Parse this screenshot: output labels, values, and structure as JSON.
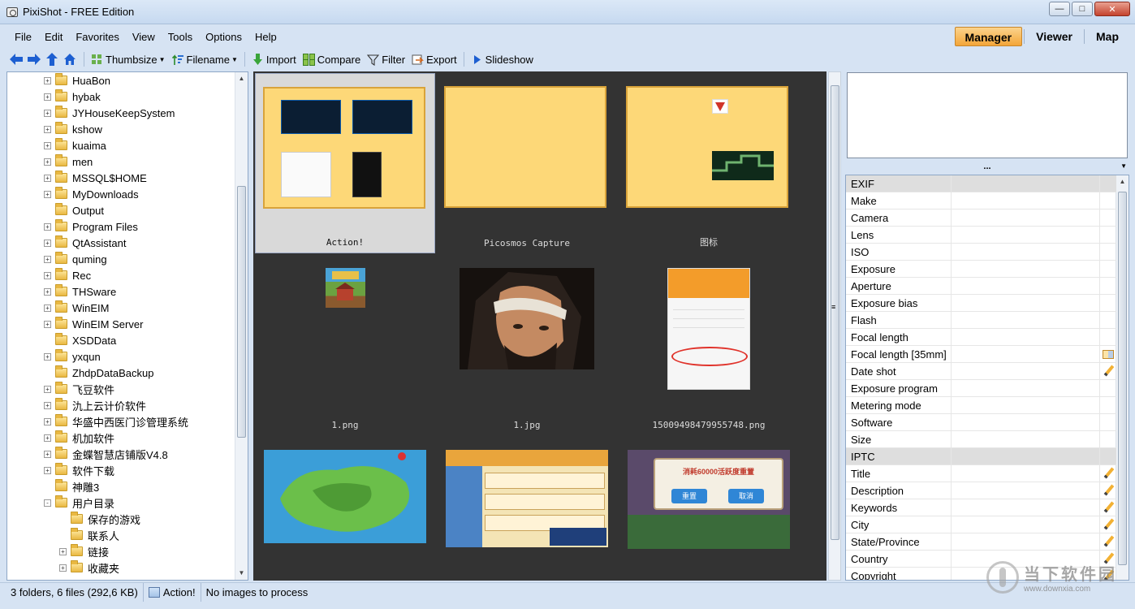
{
  "window": {
    "title": "PixiShot  -  FREE Edition"
  },
  "menu": [
    "File",
    "Edit",
    "Favorites",
    "View",
    "Tools",
    "Options",
    "Help"
  ],
  "modes": [
    {
      "label": "Manager",
      "active": true
    },
    {
      "label": "Viewer",
      "active": false
    },
    {
      "label": "Map",
      "active": false
    }
  ],
  "toolbar": {
    "thumbsize": "Thumbsize",
    "filename": "Filename",
    "import": "Import",
    "compare": "Compare",
    "filter": "Filter",
    "export": "Export",
    "slideshow": "Slideshow"
  },
  "tree": [
    {
      "label": "HuaBon",
      "expander": "+",
      "level": 1,
      "icon": "folder-icon"
    },
    {
      "label": "hybak",
      "expander": "+",
      "level": 1,
      "icon": "folder-icon"
    },
    {
      "label": "JYHouseKeepSystem",
      "expander": "+",
      "level": 1,
      "icon": "folder-icon"
    },
    {
      "label": "kshow",
      "expander": "+",
      "level": 1,
      "icon": "folder-icon"
    },
    {
      "label": "kuaima",
      "expander": "+",
      "level": 1,
      "icon": "folder-icon"
    },
    {
      "label": "men",
      "expander": "+",
      "level": 1,
      "icon": "folder-icon"
    },
    {
      "label": "MSSQL$HOME",
      "expander": "+",
      "level": 1,
      "icon": "folder-icon"
    },
    {
      "label": "MyDownloads",
      "expander": "+",
      "level": 1,
      "icon": "folder-icon"
    },
    {
      "label": "Output",
      "expander": "",
      "level": 1,
      "icon": "folder-icon"
    },
    {
      "label": "Program Files",
      "expander": "+",
      "level": 1,
      "icon": "folder-icon"
    },
    {
      "label": "QtAssistant",
      "expander": "+",
      "level": 1,
      "icon": "folder-icon"
    },
    {
      "label": "quming",
      "expander": "+",
      "level": 1,
      "icon": "folder-icon"
    },
    {
      "label": "Rec",
      "expander": "+",
      "level": 1,
      "icon": "folder-icon"
    },
    {
      "label": "THSware",
      "expander": "+",
      "level": 1,
      "icon": "folder-icon"
    },
    {
      "label": "WinEIM",
      "expander": "+",
      "level": 1,
      "icon": "folder-icon"
    },
    {
      "label": "WinEIM Server",
      "expander": "+",
      "level": 1,
      "icon": "folder-icon"
    },
    {
      "label": "XSDData",
      "expander": "",
      "level": 1,
      "icon": "folder-icon"
    },
    {
      "label": "yxqun",
      "expander": "+",
      "level": 1,
      "icon": "folder-icon"
    },
    {
      "label": "ZhdpDataBackup",
      "expander": "",
      "level": 1,
      "icon": "folder-icon"
    },
    {
      "label": "飞豆软件",
      "expander": "+",
      "level": 1,
      "icon": "folder-icon"
    },
    {
      "label": "氿上云计价软件",
      "expander": "+",
      "level": 1,
      "icon": "folder-icon"
    },
    {
      "label": "华盛中西医门诊管理系统",
      "expander": "+",
      "level": 1,
      "icon": "folder-icon"
    },
    {
      "label": "机加软件",
      "expander": "+",
      "level": 1,
      "icon": "folder-icon"
    },
    {
      "label": "金蝶智慧店铺版V4.8",
      "expander": "+",
      "level": 1,
      "icon": "folder-icon"
    },
    {
      "label": "软件下载",
      "expander": "+",
      "level": 1,
      "icon": "folder-icon"
    },
    {
      "label": "神雕3",
      "expander": "",
      "level": 1,
      "icon": "folder-icon"
    },
    {
      "label": "用户目录",
      "expander": "-",
      "level": 1,
      "icon": "folder-icon"
    },
    {
      "label": "保存的游戏",
      "expander": "",
      "level": 2,
      "icon": "folder-icon"
    },
    {
      "label": "联系人",
      "expander": "",
      "level": 2,
      "icon": "folder-icon"
    },
    {
      "label": "链接",
      "expander": "+",
      "level": 2,
      "icon": "folder-icon"
    },
    {
      "label": "收藏夹",
      "expander": "+",
      "level": 2,
      "icon": "folder-icon"
    }
  ],
  "thumbnails": [
    {
      "caption": "Action!",
      "kind": "folder",
      "selected": true
    },
    {
      "caption": "Picosmos Capture",
      "kind": "folder-empty",
      "selected": false
    },
    {
      "caption": "图标",
      "kind": "folder-icons",
      "selected": false
    },
    {
      "caption": "1.png",
      "kind": "image-small",
      "selected": false
    },
    {
      "caption": "1.jpg",
      "kind": "image-portrait",
      "selected": false
    },
    {
      "caption": "15009498479955748.png",
      "kind": "image-phone",
      "selected": false
    },
    {
      "caption": "",
      "kind": "image-map",
      "selected": false
    },
    {
      "caption": "",
      "kind": "image-game",
      "selected": false
    },
    {
      "caption": "",
      "kind": "image-dialog",
      "selected": false
    }
  ],
  "thumb_texts": {
    "dialog_title": "消耗60000活跃度重置",
    "ok": "重置",
    "cancel": "取消"
  },
  "splitter": "...",
  "properties": [
    {
      "key": "EXIF",
      "header": true,
      "edit": ""
    },
    {
      "key": "Make",
      "edit": ""
    },
    {
      "key": "Camera",
      "edit": ""
    },
    {
      "key": "Lens",
      "edit": ""
    },
    {
      "key": "ISO",
      "edit": ""
    },
    {
      "key": "Exposure",
      "edit": ""
    },
    {
      "key": "Aperture",
      "edit": ""
    },
    {
      "key": "Exposure bias",
      "edit": ""
    },
    {
      "key": "Flash",
      "edit": ""
    },
    {
      "key": "Focal length",
      "edit": ""
    },
    {
      "key": "Focal length [35mm]",
      "edit": "grid"
    },
    {
      "key": "Date shot",
      "edit": "pencil"
    },
    {
      "key": "Exposure program",
      "edit": ""
    },
    {
      "key": "Metering mode",
      "edit": ""
    },
    {
      "key": "Software",
      "edit": ""
    },
    {
      "key": "Size",
      "edit": ""
    },
    {
      "key": "IPTC",
      "header": true,
      "edit": ""
    },
    {
      "key": "Title",
      "edit": "pencil"
    },
    {
      "key": "Description",
      "edit": "pencil"
    },
    {
      "key": "Keywords",
      "edit": "pencil"
    },
    {
      "key": "City",
      "edit": "pencil"
    },
    {
      "key": "State/Province",
      "edit": "pencil"
    },
    {
      "key": "Country",
      "edit": "pencil"
    },
    {
      "key": "Copyright",
      "edit": "pencil"
    }
  ],
  "status": {
    "summary": "3 folders,  6 files  (292,6 KB)",
    "folder": "Action!",
    "process": "No images to process"
  },
  "watermark": {
    "cn": "当下软件园",
    "url": "www.downxia.com"
  }
}
